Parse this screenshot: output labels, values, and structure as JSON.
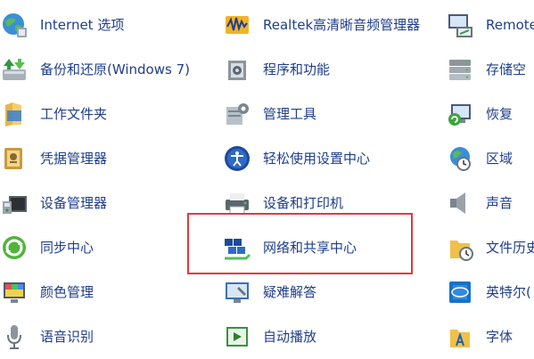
{
  "columns": [
    {
      "items": [
        {
          "label": "Internet 选项",
          "icon": "internet-options-icon"
        },
        {
          "label": "备份和还原(Windows 7)",
          "icon": "backup-restore-icon"
        },
        {
          "label": "工作文件夹",
          "icon": "work-folders-icon"
        },
        {
          "label": "凭据管理器",
          "icon": "credential-manager-icon"
        },
        {
          "label": "设备管理器",
          "icon": "device-manager-icon"
        },
        {
          "label": "同步中心",
          "icon": "sync-center-icon"
        },
        {
          "label": "颜色管理",
          "icon": "color-management-icon"
        },
        {
          "label": "语音识别",
          "icon": "speech-recognition-icon"
        }
      ]
    },
    {
      "items": [
        {
          "label": "Realtek高清晰音频管理器",
          "icon": "realtek-audio-icon"
        },
        {
          "label": "程序和功能",
          "icon": "programs-features-icon"
        },
        {
          "label": "管理工具",
          "icon": "admin-tools-icon"
        },
        {
          "label": "轻松使用设置中心",
          "icon": "ease-of-access-icon"
        },
        {
          "label": "设备和打印机",
          "icon": "devices-printers-icon"
        },
        {
          "label": "网络和共享中心",
          "icon": "network-sharing-icon"
        },
        {
          "label": "疑难解答",
          "icon": "troubleshooting-icon"
        },
        {
          "label": "自动播放",
          "icon": "autoplay-icon"
        }
      ]
    },
    {
      "items": [
        {
          "label": "Remote",
          "icon": "remote-app-icon"
        },
        {
          "label": "存储空",
          "icon": "storage-spaces-icon"
        },
        {
          "label": "恢复",
          "icon": "recovery-icon"
        },
        {
          "label": "区域",
          "icon": "region-icon"
        },
        {
          "label": "声音",
          "icon": "sound-icon"
        },
        {
          "label": "文件历史",
          "icon": "file-history-icon"
        },
        {
          "label": "英特尔(",
          "icon": "intel-graphics-icon"
        },
        {
          "label": "字体",
          "icon": "fonts-icon"
        }
      ]
    }
  ],
  "highlight_color": "#e3393d",
  "link_color": "#1f3e8c"
}
